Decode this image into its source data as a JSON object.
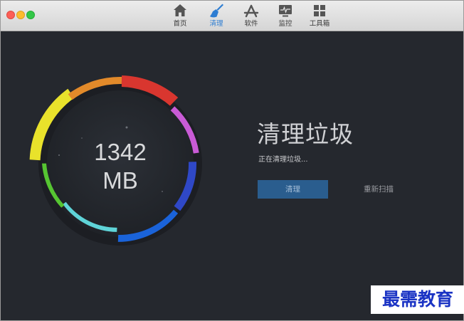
{
  "toolbar": {
    "tabs": [
      {
        "label": "首页",
        "icon": "home-icon",
        "active": false
      },
      {
        "label": "清理",
        "icon": "broom-icon",
        "active": true
      },
      {
        "label": "软件",
        "icon": "app-store-icon",
        "active": false
      },
      {
        "label": "监控",
        "icon": "monitor-icon",
        "active": false
      },
      {
        "label": "工具箱",
        "icon": "toolbox-icon",
        "active": false
      }
    ]
  },
  "gauge": {
    "value": "1342",
    "unit": "MB"
  },
  "main": {
    "title": "清理垃圾",
    "status": "正在清理垃圾..."
  },
  "actions": {
    "clean_label": "清理",
    "rescan_label": "重新扫描"
  },
  "watermark": {
    "text": "最需教育"
  },
  "colors": {
    "background": "#25282e",
    "accent": "#2d7dd2",
    "clean_button": "#2a5d8e",
    "watermark": "#1a33c4",
    "ring_segments": [
      "#e9e22b",
      "#e28a2a",
      "#d9362f",
      "#c95bd6",
      "#2f48c7",
      "#1a63d9",
      "#5fd4d8",
      "#56c532"
    ]
  }
}
